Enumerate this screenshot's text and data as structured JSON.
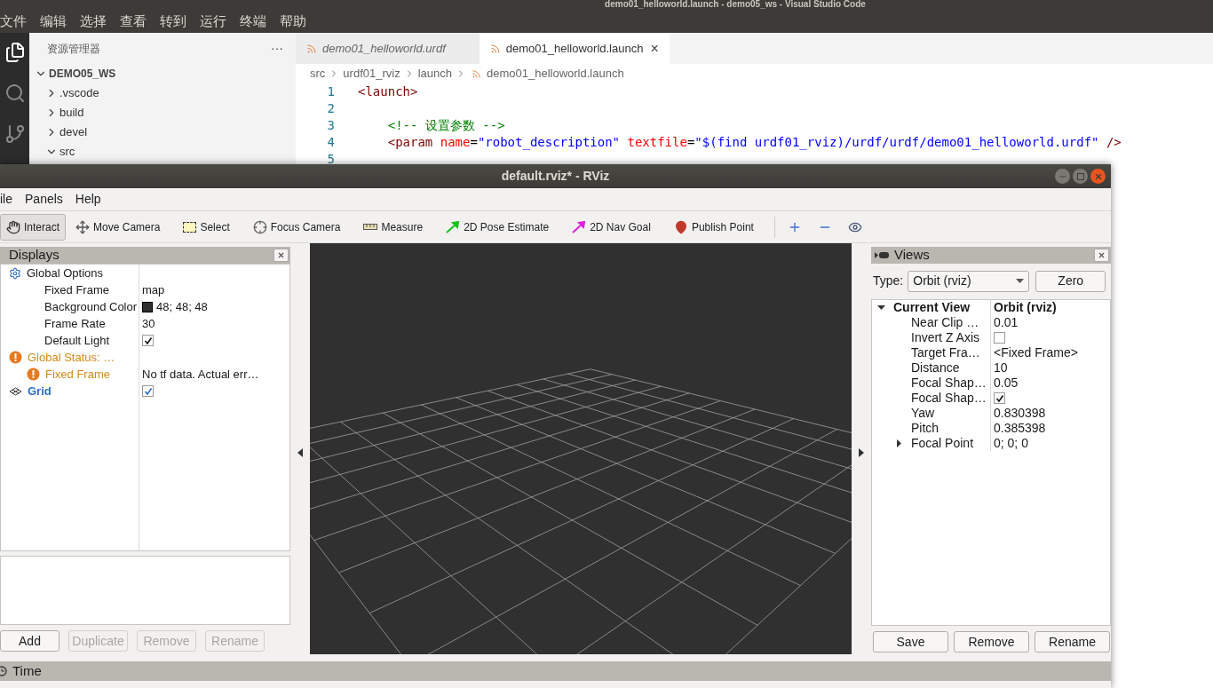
{
  "vscode": {
    "title": "demo01_helloworld.launch - demo05_ws - Visual Studio Code",
    "menu": [
      "文件",
      "编辑",
      "选择",
      "查看",
      "转到",
      "运行",
      "终端",
      "帮助"
    ],
    "explorer": {
      "title": "资源管理器",
      "more": "···",
      "workspace": "DEMO05_WS",
      "items": [
        {
          "label": ".vscode",
          "expanded": false
        },
        {
          "label": "build",
          "expanded": false
        },
        {
          "label": "devel",
          "expanded": false
        },
        {
          "label": "src",
          "expanded": true
        }
      ]
    },
    "tabs": [
      {
        "label": "demo01_helloworld.urdf",
        "selected": false,
        "preview": true
      },
      {
        "label": "demo01_helloworld.launch",
        "selected": true,
        "preview": false,
        "close": "×"
      }
    ],
    "breadcrumb": [
      "src",
      "urdf01_rviz",
      "launch",
      "demo01_helloworld.launch"
    ],
    "code": [
      {
        "number": "1",
        "tokens": [
          {
            "kind": "tag",
            "text": "<launch>"
          }
        ]
      },
      {
        "number": "2"
      },
      {
        "number": "3",
        "tokens": [
          {
            "kind": "comment",
            "text": "    <!-- 设置参数 -->"
          }
        ]
      },
      {
        "number": "4",
        "tokens": [
          {
            "kind": "tag",
            "text": "    <param"
          },
          {
            "kind": "attr",
            "text": " name"
          },
          {
            "kind": "plain",
            "text": "="
          },
          {
            "kind": "string",
            "text": "\"robot_description\""
          },
          {
            "kind": "attr",
            "text": " textfile"
          },
          {
            "kind": "plain",
            "text": "="
          },
          {
            "kind": "string",
            "text": "\"$(find urdf01_rviz)/urdf/urdf/demo01_helloworld.urdf\""
          },
          {
            "kind": "tag",
            "text": " />"
          }
        ]
      },
      {
        "number": "5"
      }
    ]
  },
  "rviz": {
    "title": "default.rviz* - RViz",
    "menu": [
      "ile",
      "Panels",
      "Help"
    ],
    "tools": [
      {
        "label": "Interact",
        "kind": "interact",
        "selected": true
      },
      {
        "label": "Move Camera",
        "kind": "move_camera",
        "selected": false
      },
      {
        "label": "Select",
        "kind": "select",
        "selected": false
      },
      {
        "label": "Focus Camera",
        "kind": "focus_camera",
        "selected": false
      },
      {
        "label": "Measure",
        "kind": "measure",
        "selected": false
      },
      {
        "label": "2D Pose Estimate",
        "kind": "pose_estimate",
        "selected": false
      },
      {
        "label": "2D Nav Goal",
        "kind": "nav_goal",
        "selected": false
      },
      {
        "label": "Publish Point",
        "kind": "publish_point",
        "selected": false
      }
    ],
    "displays": {
      "title": "Displays",
      "rows": [
        {
          "label": "Global Options",
          "kind": "options",
          "children": [
            {
              "label": "Fixed Frame",
              "kind": "property",
              "value": "map"
            },
            {
              "label": "Background Color",
              "kind": "property",
              "value": "48; 48; 48",
              "color": "#303030"
            },
            {
              "label": "Frame Rate",
              "kind": "property",
              "value": "30"
            },
            {
              "label": "Default Light",
              "kind": "property",
              "checked": true
            }
          ]
        },
        {
          "label": "Global Status: …",
          "kind": "warning",
          "children": [
            {
              "label": "Fixed Frame",
              "kind": "warning",
              "value": "No tf data.  Actual err…"
            }
          ]
        },
        {
          "label": "Grid",
          "kind": "display",
          "checked": true
        }
      ],
      "buttons": [
        {
          "label": "Add",
          "disabled": false
        },
        {
          "label": "Duplicate",
          "disabled": true
        },
        {
          "label": "Remove",
          "disabled": true
        },
        {
          "label": "Rename",
          "disabled": true
        }
      ]
    },
    "views": {
      "title": "Views",
      "type_label": "Type:",
      "type_value": "Orbit (rviz)",
      "zero": "Zero",
      "rows": [
        {
          "label": "Current View",
          "value": "Orbit (rviz)",
          "expanded": true,
          "children": [
            {
              "label": "Near Clip …",
              "value": "0.01"
            },
            {
              "label": "Invert Z Axis",
              "checked": false
            },
            {
              "label": "Target Fra…",
              "value": "<Fixed Frame>"
            },
            {
              "label": "Distance",
              "value": "10"
            },
            {
              "label": "Focal Shap…",
              "value": "0.05"
            },
            {
              "label": "Focal Shap…",
              "checked": true
            },
            {
              "label": "Yaw",
              "value": "0.830398"
            },
            {
              "label": "Pitch",
              "value": "0.385398"
            },
            {
              "label": "Focal Point",
              "expanded": false,
              "value": "0; 0; 0"
            }
          ]
        }
      ],
      "buttons": [
        "Save",
        "Remove",
        "Rename"
      ]
    },
    "time": {
      "title": "Time"
    }
  }
}
